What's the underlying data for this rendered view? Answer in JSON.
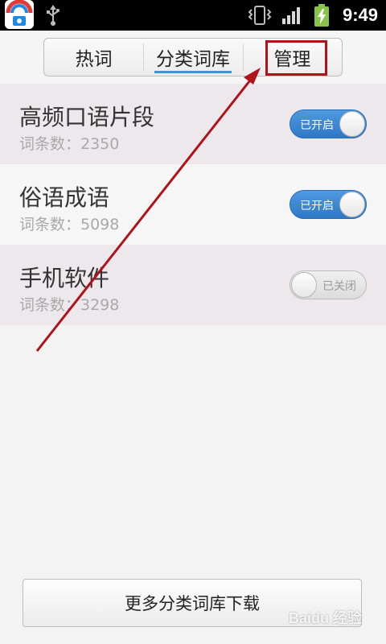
{
  "status_bar": {
    "time": "9:49",
    "icons": [
      "app-icon",
      "usb-icon",
      "vibrate-icon",
      "signal-icon",
      "battery-charging-icon"
    ]
  },
  "tabs": [
    {
      "label": "热词",
      "active": false
    },
    {
      "label": "分类词库",
      "active": true
    },
    {
      "label": "管理",
      "active": false
    }
  ],
  "list": [
    {
      "title": "高频口语片段",
      "count": "词条数：2350",
      "toggle": "已开启",
      "enabled": true
    },
    {
      "title": "俗语成语",
      "count": "词条数：5098",
      "toggle": "已开启",
      "enabled": true
    },
    {
      "title": "手机软件",
      "count": "词条数：3298",
      "toggle": "已关闭",
      "enabled": false
    }
  ],
  "download_button": "更多分类词库下载",
  "watermark": "Baidu 经验",
  "colors": {
    "accent": "#3a96d6",
    "toggle_on": "#3a86d2",
    "annotation": "#b0121a"
  }
}
